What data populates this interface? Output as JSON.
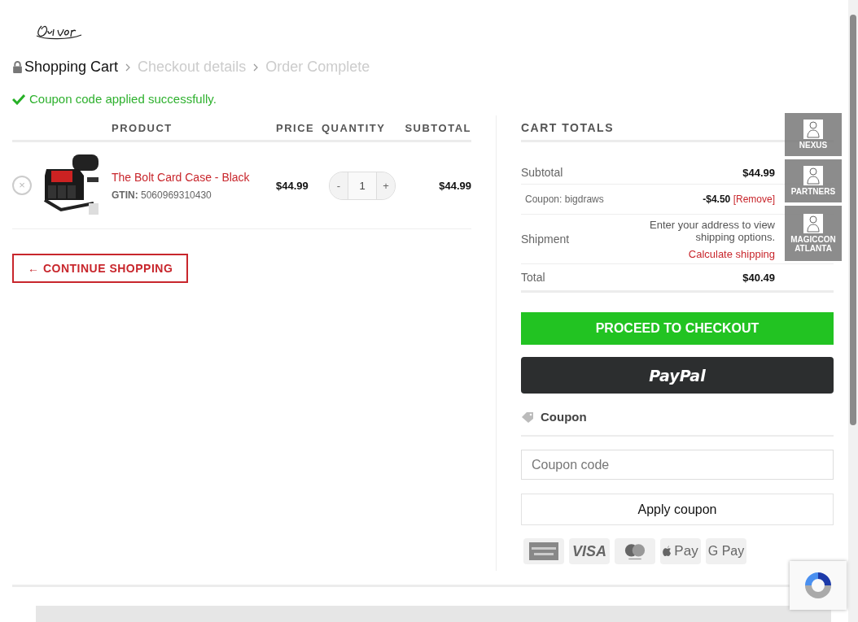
{
  "breadcrumb": [
    {
      "label": "Shopping Cart",
      "selected": true
    },
    {
      "label": "Checkout details",
      "selected": false
    },
    {
      "label": "Order Complete",
      "selected": false
    }
  ],
  "notice": "Coupon code applied successfully.",
  "cart": {
    "columns": [
      "PRODUCT",
      "PRICE",
      "QUANTITY",
      "SUBTOTAL"
    ],
    "rows": [
      {
        "name": "The Bolt Card Case - Black",
        "gtin_label": "GTIN:",
        "gtin": "5060969310430",
        "price": "$44.99",
        "quantity": "1",
        "minus": "-",
        "plus": "+",
        "subtotal": "$44.99",
        "remove": "×"
      }
    ]
  },
  "continue_button": "← CONTINUE SHOPPING",
  "totals": {
    "title": "CART TOTALS",
    "rows": [
      {
        "kind": "line",
        "label": "Subtotal",
        "value": "$44.99"
      },
      {
        "kind": "coupon",
        "label": "Coupon: bigdraws",
        "value": "-$4.50",
        "link": "[Remove]"
      },
      {
        "kind": "shipping",
        "label": "Shipment",
        "note": "Enter your address to view shipping options.",
        "link": "Calculate shipping"
      },
      {
        "kind": "total",
        "label": "Total",
        "value": "$40.49"
      }
    ]
  },
  "checkout_button": "PROCEED TO CHECKOUT",
  "paypal_button": "PayPal",
  "coupon": {
    "title": "Coupon",
    "placeholder": "Coupon code",
    "button": "Apply coupon"
  },
  "payment_icons": [
    {
      "kind": "amex"
    },
    {
      "kind": "text",
      "label": "VISA"
    },
    {
      "kind": "mastercard"
    },
    {
      "kind": "apple",
      "label": "Pay"
    },
    {
      "kind": "text",
      "label": "G Pay"
    }
  ],
  "side_tabs": [
    {
      "label": "NEXUS"
    },
    {
      "label": "PARTNERS"
    },
    {
      "label": "MAGICCON ATLANTA"
    }
  ]
}
